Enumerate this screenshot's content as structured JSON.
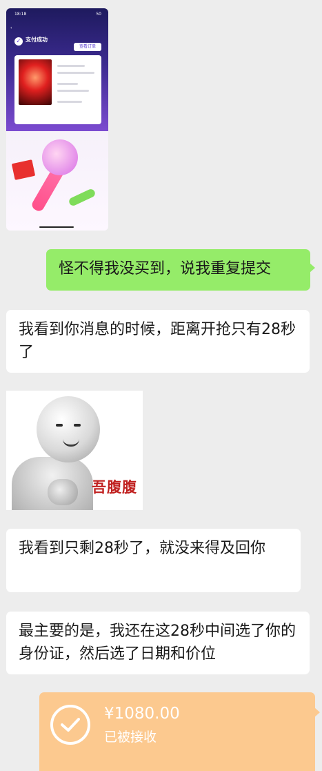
{
  "messages": {
    "m1_right": "怪不得我没买到，说我重复提交",
    "m2_left": "我看到你消息的时候，距离开抢只有28秒了",
    "m3_left": "我看到只剩28秒了，就没来得及回你",
    "m4_left": "最主要的是，我还在这28秒中间选了你的身份证，然后选了日期和价位"
  },
  "screenshot": {
    "time": "18:18",
    "battery": "50",
    "pay_title": "支付成功",
    "view_order": "查看订单"
  },
  "sticker": {
    "caption": "吾腹腹"
  },
  "transfer": {
    "amount": "¥1080.00",
    "status": "已被接收"
  },
  "colors": {
    "chat_bg": "#ededed",
    "sent_bubble": "#95ec69",
    "received_bubble": "#ffffff",
    "transfer_card": "#fcc98f"
  }
}
